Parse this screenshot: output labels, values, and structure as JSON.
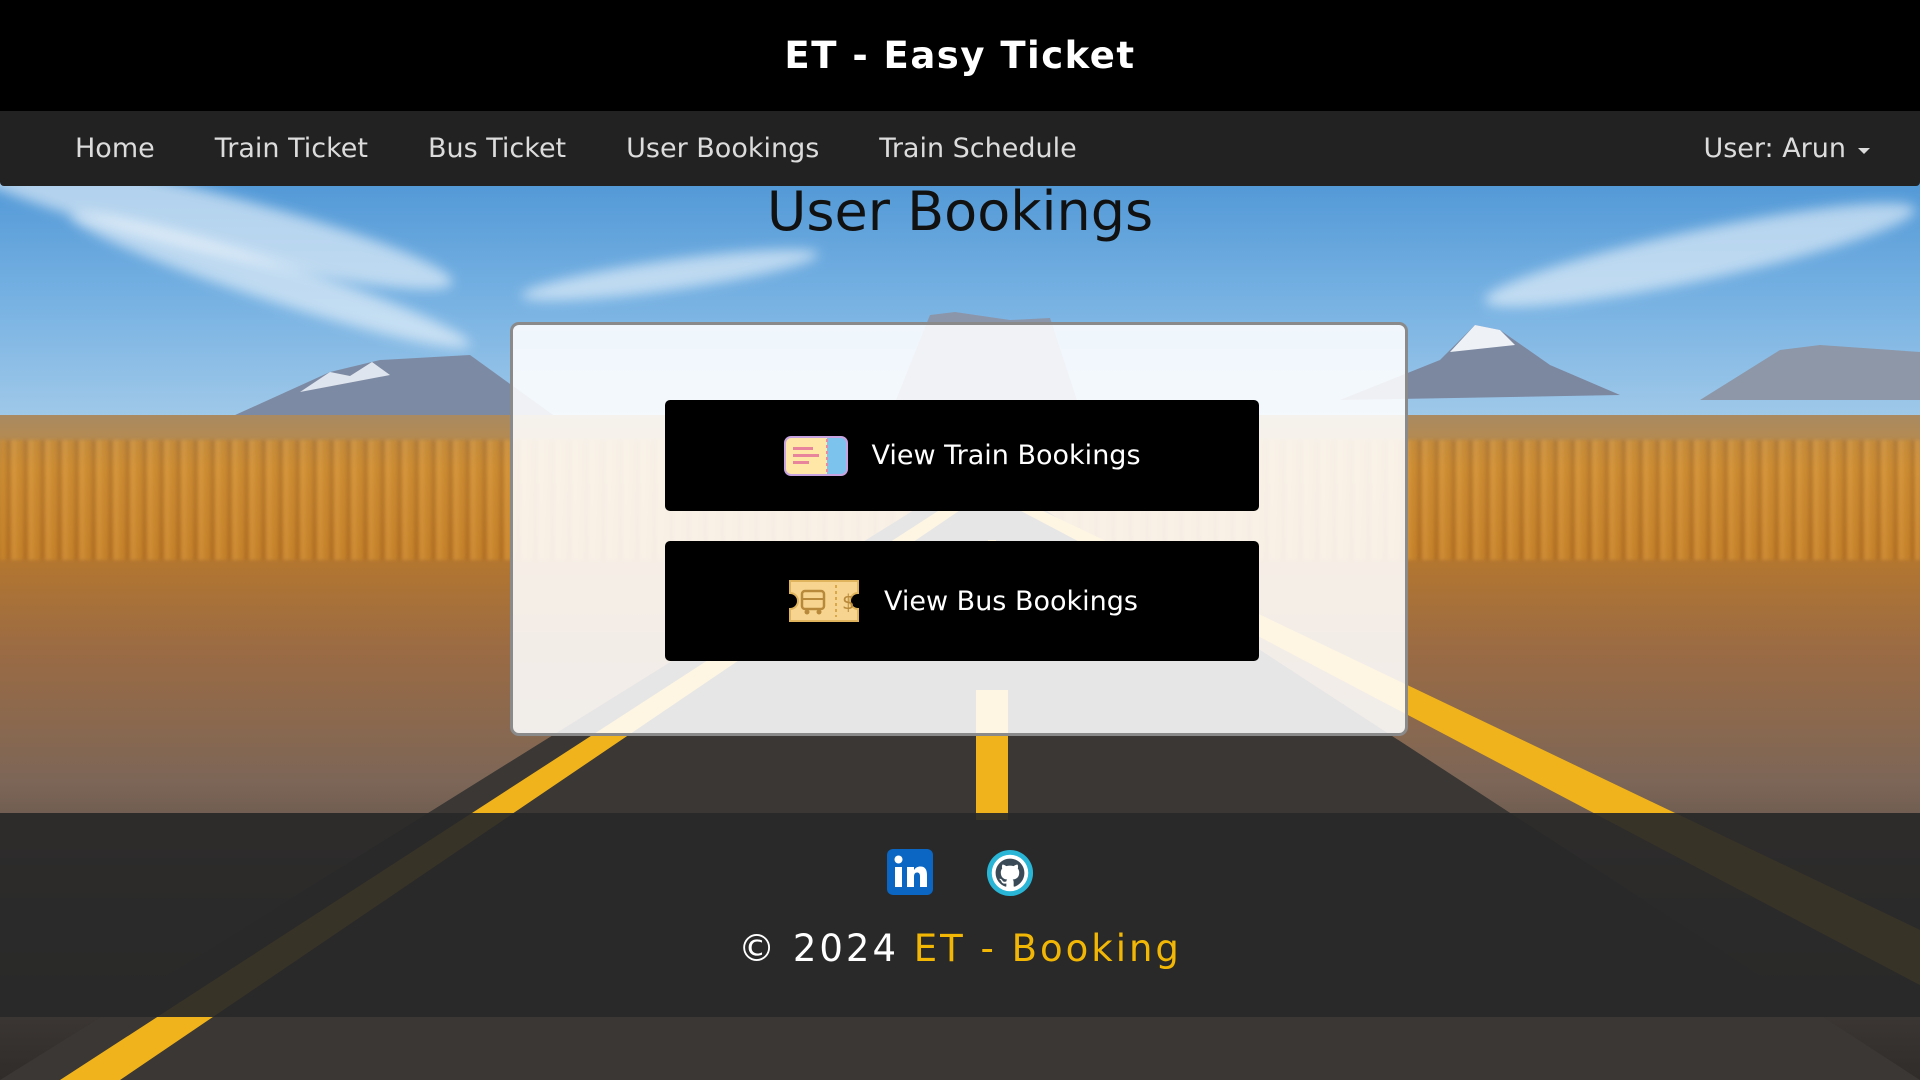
{
  "header": {
    "title": "ET - Easy Ticket"
  },
  "nav": {
    "items": [
      {
        "label": "Home"
      },
      {
        "label": "Train Ticket"
      },
      {
        "label": "Bus Ticket"
      },
      {
        "label": "User Bookings"
      },
      {
        "label": "Train Schedule"
      }
    ],
    "user_menu": {
      "label": "User: Arun",
      "icon": "caret-down-icon"
    }
  },
  "main": {
    "heading": "User Bookings",
    "buttons": [
      {
        "label": "View Train Bookings",
        "icon": "train-ticket-icon"
      },
      {
        "label": "View Bus Bookings",
        "icon": "bus-ticket-icon"
      }
    ]
  },
  "footer": {
    "social": [
      {
        "name": "linkedin",
        "icon": "linkedin-icon",
        "color": "#0a66c2"
      },
      {
        "name": "github",
        "icon": "github-icon",
        "color": "#29b6d6"
      }
    ],
    "copyright_prefix": "© 2024",
    "brand": "ET - Booking",
    "brand_color": "#f2b705"
  },
  "colors": {
    "topbar_bg": "#000000",
    "navbar_bg": "#222222",
    "button_bg": "#000000"
  }
}
